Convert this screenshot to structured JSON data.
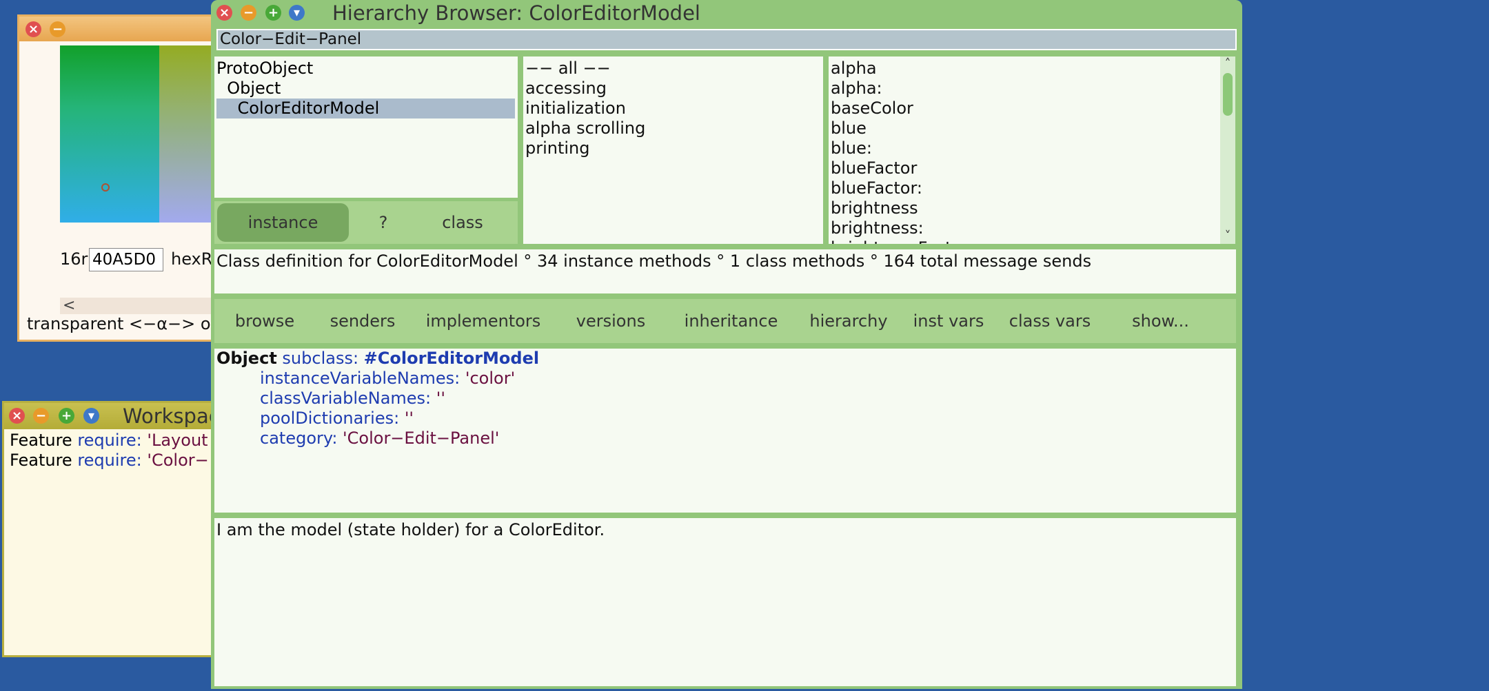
{
  "color_editor": {
    "hex_prefix": "16r",
    "hex_value": "40A5D0",
    "hex_suffix": "hexR",
    "alpha_arrow": "<",
    "alpha_label": "transparent <−α−> o"
  },
  "workspace": {
    "title": "Workspac",
    "lines": [
      {
        "a": "Feature ",
        "b": "require: ",
        "c": "'Layout"
      },
      {
        "a": "Feature ",
        "b": "require: ",
        "c": "'Color−"
      }
    ]
  },
  "browser": {
    "title": "Hierarchy Browser: ColorEditorModel",
    "search_text": "Color−Edit−Panel",
    "classes": [
      "ProtoObject",
      "  Object",
      "    ColorEditorModel"
    ],
    "selected_class_index": 2,
    "switch": {
      "instance": "instance",
      "question": "?",
      "class": "class"
    },
    "categories": [
      "−− all −−",
      "accessing",
      "initialization",
      "alpha scrolling",
      "printing"
    ],
    "selectors": [
      "alpha",
      "alpha:",
      "baseColor",
      "blue",
      "blue:",
      "blueFactor",
      "blueFactor:",
      "brightness",
      "brightness:",
      "brightnessFactor"
    ],
    "scroll_up": "˄",
    "scroll_down": "˅",
    "info": "Class definition for ColorEditorModel ° 34 instance methods ° 1 class methods ° 164 total message sends",
    "actions": [
      "browse",
      "senders",
      "implementors",
      "versions",
      "inheritance",
      "hierarchy",
      "inst vars",
      "class vars",
      "show..."
    ],
    "code": {
      "superclass": "Object",
      "subclass_kw": " subclass: ",
      "class_sym": "#ColorEditorModel",
      "ivn_kw": "instanceVariableNames: ",
      "ivn_val": "'color'",
      "cvn_kw": "classVariableNames: ",
      "cvn_val": "''",
      "pd_kw": "poolDictionaries: ",
      "pd_val": "''",
      "cat_kw": "category: ",
      "cat_val": "'Color−Edit−Panel'"
    },
    "comment": "I am the model (state holder) for a ColorEditor."
  },
  "window_buttons": {
    "close": "×",
    "minimize": "−",
    "maximize": "+",
    "menu": "▾"
  }
}
